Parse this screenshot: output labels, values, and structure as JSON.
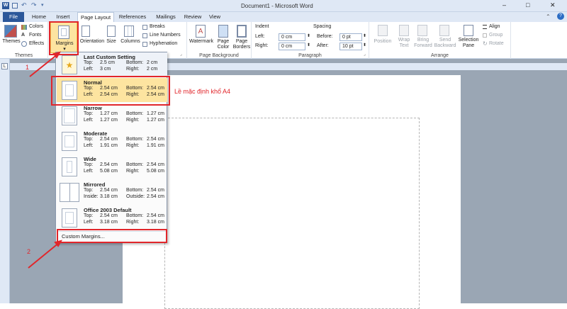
{
  "title": "Document1 - Microsoft Word",
  "window": {
    "minimize": "–",
    "maximize": "□",
    "close": "✕"
  },
  "tabs": [
    "File",
    "Home",
    "Insert",
    "Page Layout",
    "References",
    "Mailings",
    "Review",
    "View"
  ],
  "ribbon": {
    "themes": {
      "label": "Themes",
      "group": "Themes",
      "colors": "Colors",
      "fonts": "Fonts",
      "effects": "Effects"
    },
    "page_setup": {
      "margins": "Margins",
      "orientation": "Orientation",
      "size": "Size",
      "columns": "Columns",
      "breaks": "Breaks",
      "line_numbers": "Line Numbers",
      "hyphenation": "Hyphenation"
    },
    "page_background": {
      "group": "Page Background",
      "watermark": "Watermark",
      "page_color": "Page Color",
      "page_borders": "Page Borders"
    },
    "paragraph": {
      "group": "Paragraph",
      "indent": "Indent",
      "left_label": "Left:",
      "left_value": "0 cm",
      "right_label": "Right:",
      "right_value": "0 cm",
      "spacing": "Spacing",
      "before_label": "Before:",
      "before_value": "0 pt",
      "after_label": "After:",
      "after_value": "10 pt"
    },
    "arrange": {
      "group": "Arrange",
      "position": "Position",
      "wrap_text": "Wrap Text",
      "bring_forward": "Bring Forward",
      "send_backward": "Send Backward",
      "selection_pane": "Selection Pane",
      "align": "Align",
      "group_btn": "Group",
      "rotate": "Rotate"
    }
  },
  "margins_menu": {
    "items": [
      {
        "name": "Last Custom Setting",
        "l1": "Top:",
        "v1": "2.5 cm",
        "l2": "Bottom:",
        "v2": "2 cm",
        "l3": "Left:",
        "v3": "3 cm",
        "l4": "Right:",
        "v4": "2 cm"
      },
      {
        "name": "Normal",
        "l1": "Top:",
        "v1": "2.54 cm",
        "l2": "Bottom:",
        "v2": "2.54 cm",
        "l3": "Left:",
        "v3": "2.54 cm",
        "l4": "Right:",
        "v4": "2.54 cm"
      },
      {
        "name": "Narrow",
        "l1": "Top:",
        "v1": "1.27 cm",
        "l2": "Bottom:",
        "v2": "1.27 cm",
        "l3": "Left:",
        "v3": "1.27 cm",
        "l4": "Right:",
        "v4": "1.27 cm"
      },
      {
        "name": "Moderate",
        "l1": "Top:",
        "v1": "2.54 cm",
        "l2": "Bottom:",
        "v2": "2.54 cm",
        "l3": "Left:",
        "v3": "1.91 cm",
        "l4": "Right:",
        "v4": "1.91 cm"
      },
      {
        "name": "Wide",
        "l1": "Top:",
        "v1": "2.54 cm",
        "l2": "Bottom:",
        "v2": "2.54 cm",
        "l3": "Left:",
        "v3": "5.08 cm",
        "l4": "Right:",
        "v4": "5.08 cm"
      },
      {
        "name": "Mirrored",
        "l1": "Top:",
        "v1": "2.54 cm",
        "l2": "Bottom:",
        "v2": "2.54 cm",
        "l3": "Inside:",
        "v3": "3.18 cm",
        "l4": "Outside:",
        "v4": "2.54 cm"
      },
      {
        "name": "Office 2003 Default",
        "l1": "Top:",
        "v1": "2.54 cm",
        "l2": "Bottom:",
        "v2": "2.54 cm",
        "l3": "Left:",
        "v3": "3.18 cm",
        "l4": "Right:",
        "v4": "3.18 cm"
      }
    ],
    "custom": "Custom Margins..."
  },
  "annotations": {
    "step1": "1",
    "step2": "2",
    "note": "Lề mặc định khổ A4"
  }
}
